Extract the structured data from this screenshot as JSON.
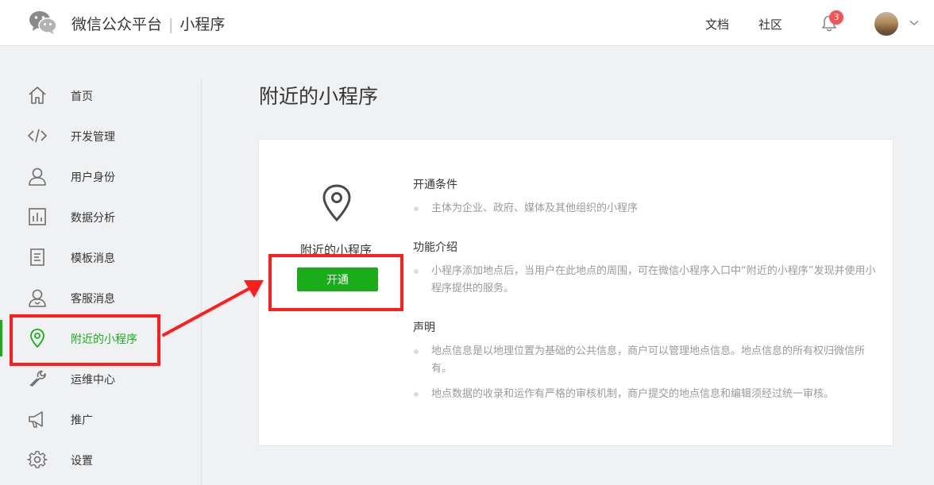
{
  "header": {
    "brand": "微信公众平台",
    "separator": "|",
    "product": "小程序",
    "links": [
      {
        "label": "文档"
      },
      {
        "label": "社区"
      }
    ],
    "notification_count": "3"
  },
  "sidebar": {
    "items": [
      {
        "label": "首页",
        "icon": "home-icon"
      },
      {
        "label": "开发管理",
        "icon": "code-icon"
      },
      {
        "label": "用户身份",
        "icon": "user-icon"
      },
      {
        "label": "数据分析",
        "icon": "chart-icon"
      },
      {
        "label": "模板消息",
        "icon": "document-icon"
      },
      {
        "label": "客服消息",
        "icon": "customer-service-icon"
      },
      {
        "label": "附近的小程序",
        "icon": "location-pin-icon",
        "active": true
      },
      {
        "label": "运维中心",
        "icon": "wrench-icon"
      },
      {
        "label": "推广",
        "icon": "megaphone-icon"
      },
      {
        "label": "设置",
        "icon": "gear-icon"
      }
    ]
  },
  "main": {
    "title": "附近的小程序",
    "feature": {
      "name": "附近的小程序",
      "button_label": "开通"
    },
    "sections": [
      {
        "title": "开通条件",
        "items": [
          "主体为企业、政府、媒体及其他组织的小程序"
        ]
      },
      {
        "title": "功能介绍",
        "items": [
          "小程序添加地点后，当用户在此地点的周围，可在微信小程序入口中“附近的小程序”发现并使用小程序提供的服务。"
        ]
      },
      {
        "title": "声明",
        "items": [
          "地点信息是以地理位置为基础的公共信息，商户可以管理地点信息。地点信息的所有权归微信所有。",
          "地点数据的收录和运作有严格的审核机制，商户提交的地点信息和编辑须经过统一审核。"
        ]
      }
    ]
  },
  "colors": {
    "accent": "#1aad19",
    "annotation": "#ff1e1e",
    "badge": "#fa5151"
  }
}
